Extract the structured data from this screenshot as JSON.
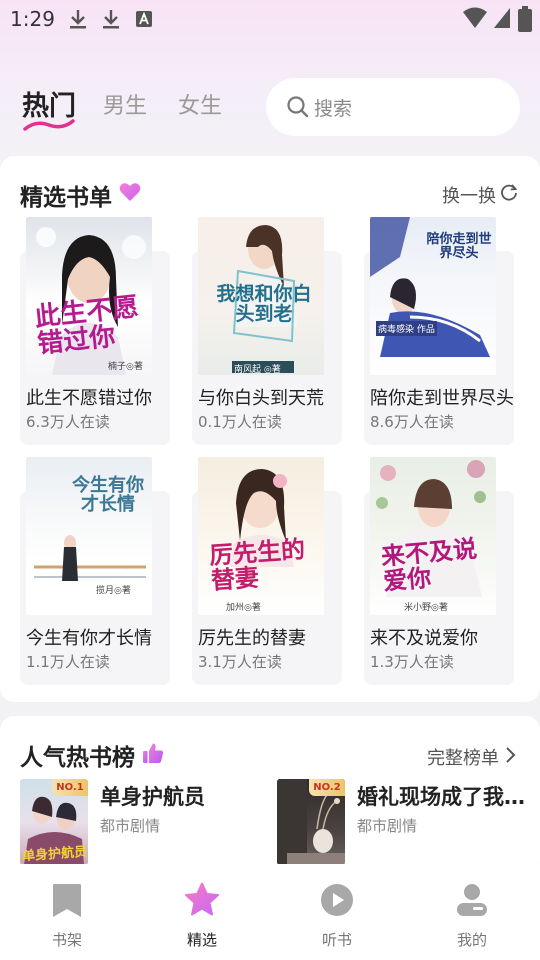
{
  "status_bar": {
    "time": "1:29"
  },
  "top_tabs": [
    {
      "label": "热门",
      "active": true
    },
    {
      "label": "男生",
      "active": false
    },
    {
      "label": "女生",
      "active": false
    }
  ],
  "search": {
    "placeholder": "搜索"
  },
  "featured": {
    "title": "精选书单",
    "refresh_label": "换一换",
    "books": [
      {
        "name": "此生不愿错过你",
        "readers": "6.3万人在读",
        "cover_title": "此生不愿错过你",
        "cover_author": "楠子◎著"
      },
      {
        "name": "与你白头到天荒",
        "readers": "0.1万人在读",
        "cover_title": "我想和你白头到老",
        "cover_author": "南风起 ◎著"
      },
      {
        "name": "陪你走到世界尽头",
        "readers": "8.6万人在读",
        "cover_title": "陪你走到世界尽头",
        "cover_author": "病毒感染 作品"
      },
      {
        "name": "今生有你才长情",
        "readers": "1.1万人在读",
        "cover_title": "今生有你才长情",
        "cover_author": "揽月◎著"
      },
      {
        "name": "厉先生的替妻",
        "readers": "3.1万人在读",
        "cover_title": "厉先生的替妻",
        "cover_author": "加州◎著"
      },
      {
        "name": "来不及说爱你",
        "readers": "1.3万人在读",
        "cover_title": "来不及说爱你",
        "cover_author": "米小野◎著"
      }
    ]
  },
  "hot_list": {
    "title": "人气热书榜",
    "full_list_label": "完整榜单",
    "items": [
      {
        "rank": "NO.1",
        "title": "单身护航员",
        "genre": "都市剧情",
        "cover_title": "单身护航员"
      },
      {
        "rank": "NO.2",
        "title": "婚礼现场成了我…",
        "genre": "都市剧情"
      }
    ]
  },
  "bottom_nav": [
    {
      "label": "书架",
      "icon": "bookmark-icon",
      "active": false
    },
    {
      "label": "精选",
      "icon": "star-icon",
      "active": true
    },
    {
      "label": "听书",
      "icon": "play-icon",
      "active": false
    },
    {
      "label": "我的",
      "icon": "user-icon",
      "active": false
    }
  ],
  "colors": {
    "accent_pink": "#e2328f",
    "star_gradient": "#f08ad0"
  }
}
